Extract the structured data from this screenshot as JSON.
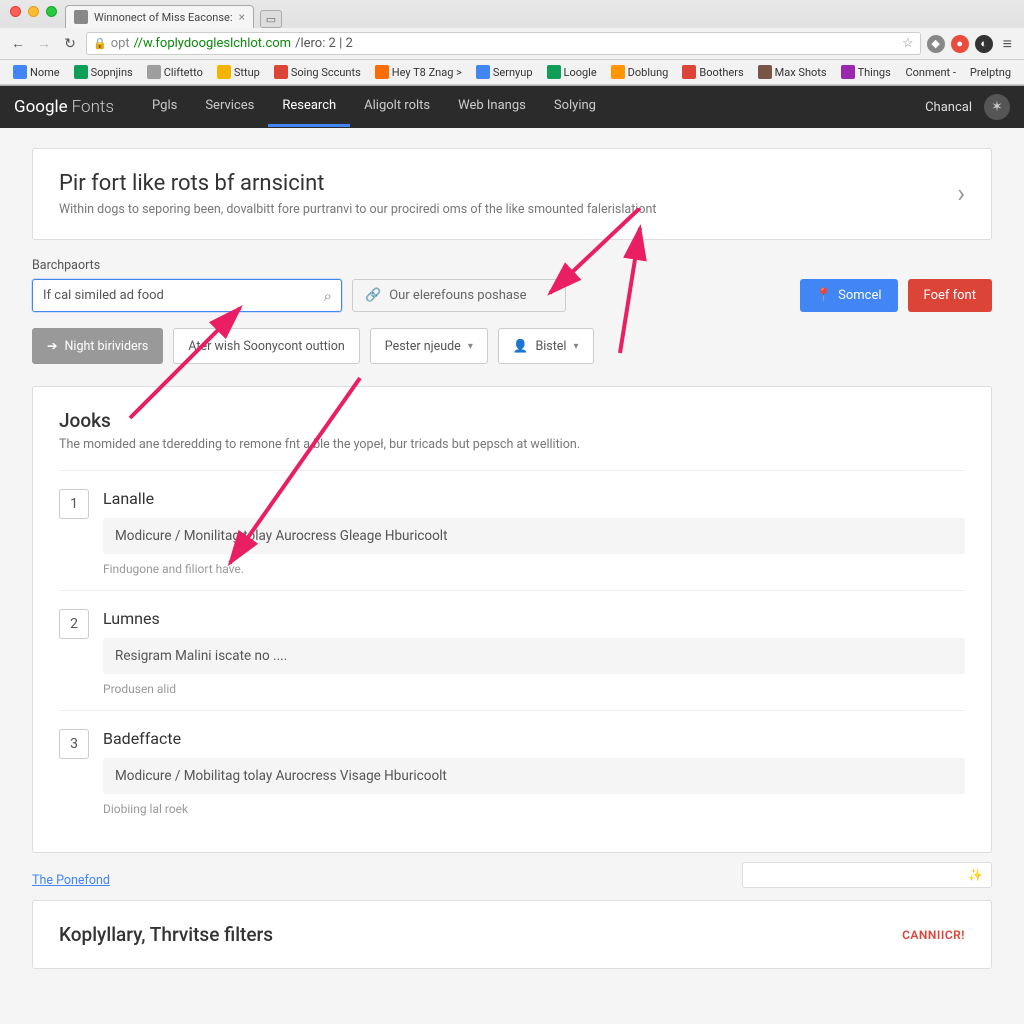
{
  "browser": {
    "tab_title": "Winnonect of Miss Eaconse:",
    "url_protocol": "opt",
    "url_host": "//w.foplydoogleslchlot.com",
    "url_path": "/lero: 2 | 2",
    "bookmarks": [
      {
        "label": "Nome",
        "color": "#4285f4"
      },
      {
        "label": "Sopnjins",
        "color": "#0f9d58"
      },
      {
        "label": "Cliftetto",
        "color": "#9e9e9e"
      },
      {
        "label": "Sttup",
        "color": "#f4b400"
      },
      {
        "label": "Soing Sccunts",
        "color": "#db4437"
      },
      {
        "label": "Hey T8 Znag >",
        "color": "#ff6d00"
      },
      {
        "label": "Sernyup",
        "color": "#4285f4"
      },
      {
        "label": "Loogle",
        "color": "#0f9d58"
      },
      {
        "label": "Doblung",
        "color": "#ff9800"
      },
      {
        "label": "Boothers",
        "color": "#db4437"
      },
      {
        "label": "Max Shots",
        "color": "#795548"
      },
      {
        "label": "Things",
        "color": "#9c27b0"
      }
    ],
    "bookmarks_right": [
      {
        "label": "Conment -"
      },
      {
        "label": "Prelptng"
      }
    ]
  },
  "header": {
    "logo_google": "Google",
    "logo_fonts": "Fonts",
    "nav": [
      "Pgls",
      "Services",
      "Research",
      "Aligolt rolts",
      "Web Inangs",
      "Solying"
    ],
    "active_index": 2,
    "right_label": "Chancal"
  },
  "hero": {
    "title": "Pir fort like rots bf arnsicint",
    "subtitle": "Within dogs to seporing been, dovalbitt fore purtranvi to our prociredi oms of the like smounted falerislationt"
  },
  "search": {
    "label": "Barchpaorts",
    "value": "If cal similed ad food",
    "link_text": "Our elerefouns poshase",
    "btn_primary": "Somcel",
    "btn_secondary": "Foef font"
  },
  "filters": {
    "f1": "Night birividers",
    "f2": "Ater wish Soonycont outtion",
    "f3": "Pester njeude",
    "f4": "Bistel"
  },
  "results": {
    "heading": "Jooks",
    "sub": "The momided ane tderedding to remone fnt a ble the yopeł, bur tricads but pepsch at wellition.",
    "items": [
      {
        "num": "1",
        "title": "Lanalle",
        "preview": "Modicure / Monilitag tolay Aurocress Gleage Hburicoolt",
        "meta": "Findugone and filiort have."
      },
      {
        "num": "2",
        "title": "Lumnes",
        "preview": "Resigram Malini iscate no ....",
        "meta": "Produsen alid"
      },
      {
        "num": "3",
        "title": "Badeffacte",
        "preview": "Modicure / Mobilitag tolay Aurocress Visage Hburicoolt",
        "meta": "Diobiing lal roek"
      }
    ]
  },
  "footer_link": "The Ponefond",
  "lower": {
    "title": "Koplyllary, Thrvitse filters",
    "link": "CANNIICR!"
  }
}
